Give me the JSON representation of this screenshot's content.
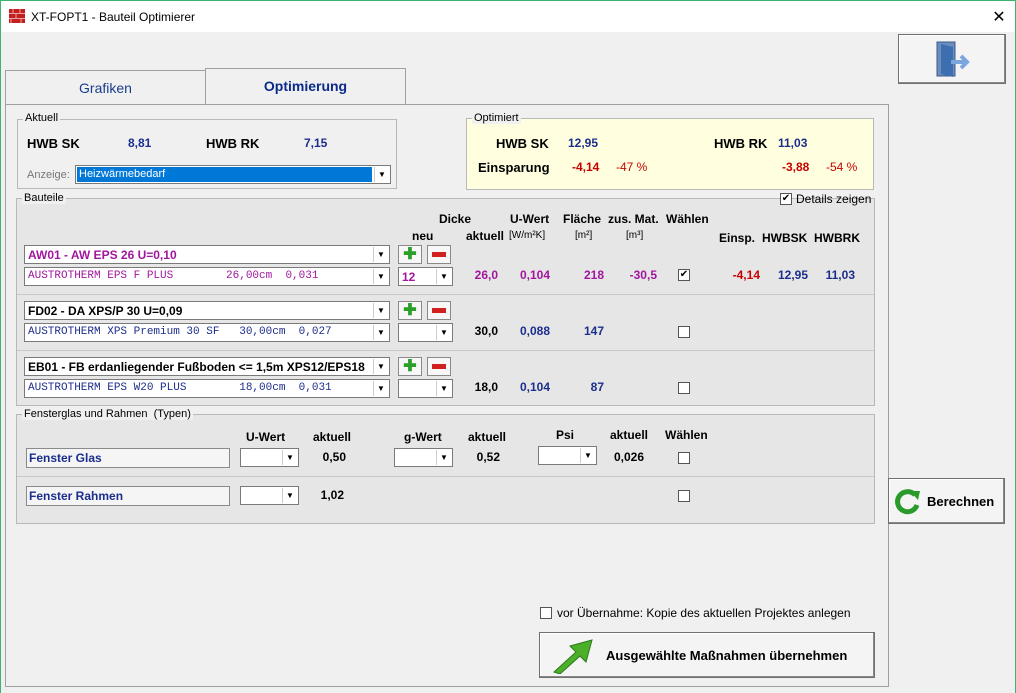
{
  "window": {
    "title": "XT-FOPT1 - Bauteil Optimierer",
    "close_glyph": "✕"
  },
  "tabs": [
    {
      "label": "Grafiken"
    },
    {
      "label": "Optimierung"
    }
  ],
  "aktuell": {
    "legend": "Aktuell",
    "hwb_sk_label": "HWB SK",
    "hwb_sk_value": "8,81",
    "hwb_rk_label": "HWB RK",
    "hwb_rk_value": "7,15",
    "anzeige_label": "Anzeige:",
    "anzeige_value": "Heizwärmebedarf"
  },
  "optimiert": {
    "legend": "Optimiert",
    "hwb_sk_label": "HWB SK",
    "hwb_sk_value": "12,95",
    "hwb_rk_label": "HWB RK",
    "hwb_rk_value": "11,03",
    "einsparung_label": "Einsparung",
    "sk_diff": "-4,14",
    "sk_pct": "-47 %",
    "rk_diff": "-3,88",
    "rk_pct": "-54 %"
  },
  "bauteile": {
    "legend": "Bauteile",
    "details_label": "Details zeigen",
    "details_checked": true,
    "headers": {
      "dicke": "Dicke",
      "neu": "neu",
      "aktuell": "aktuell",
      "uwert": "U-Wert",
      "uwert_unit": "[W/m²K]",
      "flaeche": "Fläche",
      "flaeche_unit": "[m²]",
      "zusmat": "zus. Mat.",
      "zusmat_unit": "[m³]",
      "waehlen": "Wählen",
      "einsp": "Einsp.",
      "hwbsk": "HWBSK",
      "hwbrk": "HWBRK"
    },
    "rows": [
      {
        "name": "AW01 - AW EPS 26 U=0,10",
        "material": "AUSTROTHERM EPS F PLUS        26,00cm  0,031",
        "neu": "12",
        "aktuell": "26,0",
        "uwert": "0,104",
        "flaeche": "218",
        "zusmat": "-30,5",
        "checked": true,
        "einsp": "-4,14",
        "hwbsk": "12,95",
        "hwbrk": "11,03"
      },
      {
        "name": "FD02 - DA XPS/P 30 U=0,09",
        "material": "AUSTROTHERM XPS Premium 30 SF   30,00cm  0,027",
        "neu": "",
        "aktuell": "30,0",
        "uwert": "0,088",
        "flaeche": "147",
        "zusmat": "",
        "checked": false,
        "einsp": "",
        "hwbsk": "",
        "hwbrk": ""
      },
      {
        "name": "EB01 - FB  erdanliegender Fußboden <= 1,5m XPS12/EPS18",
        "material": "AUSTROTHERM EPS W20 PLUS        18,00cm  0,031",
        "neu": "",
        "aktuell": "18,0",
        "uwert": "0,104",
        "flaeche": "87",
        "zusmat": "",
        "checked": false,
        "einsp": "",
        "hwbsk": "",
        "hwbrk": ""
      }
    ]
  },
  "fenster": {
    "legend": "Fensterglas und Rahmen  (Typen)",
    "headers": {
      "uwert": "U-Wert",
      "aktuell1": "aktuell",
      "gwert": "g-Wert",
      "aktuell2": "aktuell",
      "psi": "Psi",
      "aktuell3": "aktuell",
      "waehlen": "Wählen"
    },
    "glas": {
      "label": "Fenster Glas",
      "u_aktuell": "0,50",
      "g_aktuell": "0,52",
      "psi_aktuell": "0,026"
    },
    "rahmen": {
      "label": "Fenster Rahmen",
      "u_aktuell": "1,02"
    }
  },
  "berechnen_label": "Berechnen",
  "kopie_label": "vor Übernahme: Kopie des aktuellen Projektes anlegen",
  "uebernehmen_label": "Ausgewählte Maßnahmen übernehmen",
  "colors": {
    "accent_green": "#3cb371",
    "value_blue": "#1c2e8c",
    "value_purple": "#a0179d",
    "value_red": "#c80000",
    "optimiert_bg": "#ffffe0"
  }
}
